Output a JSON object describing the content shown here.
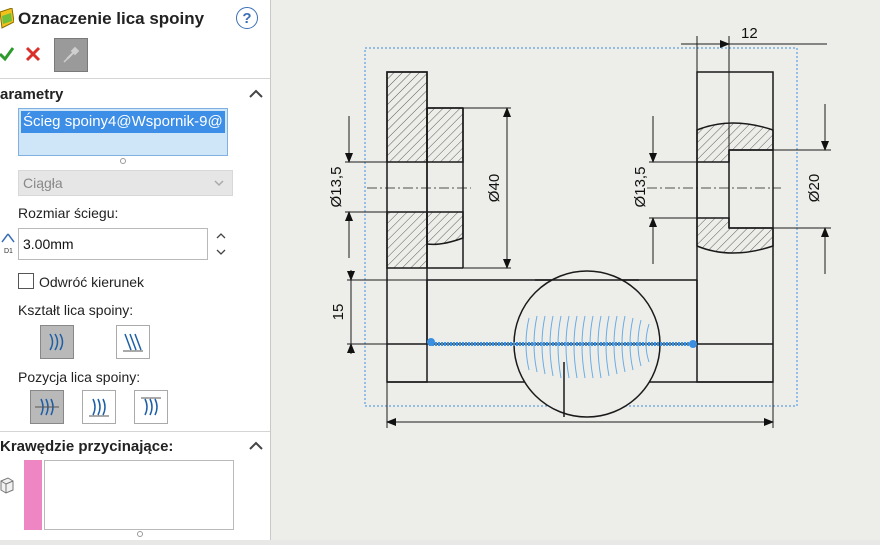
{
  "panel": {
    "title": "Oznaczenie lica spoiny",
    "help_symbol": "?",
    "ok_icon": "check-icon",
    "cancel_icon": "close-icon",
    "pin_icon": "pushpin-icon"
  },
  "params": {
    "header": "arametry",
    "selected_entity": "Ścieg spoiny4@Wspornik-9@",
    "weld_type": "Ciągła",
    "bead_size_label": "Rozmiar ściegu:",
    "bead_size_value": "3.00mm",
    "bead_size_icon_text": "D1",
    "reverse_direction_label": "Odwróć kierunek",
    "reverse_direction_checked": false,
    "face_shape_label": "Kształt lica spoiny:",
    "face_position_label": "Pozycja lica spoiny:"
  },
  "trim": {
    "header": "Krawędzie przycinające:",
    "swatch_color": "#ef86c4"
  },
  "drawing": {
    "dim_top_width": "12",
    "dim_left_dia_small": "13,5",
    "dim_left_dia_big": "40",
    "dim_right_dia_small": "13,5",
    "dim_right_dia_big": "20",
    "dim_height": "15",
    "dia_symbol": "Ø",
    "line_color": "#1a1a1a",
    "weld_color": "#3b8fe0"
  }
}
